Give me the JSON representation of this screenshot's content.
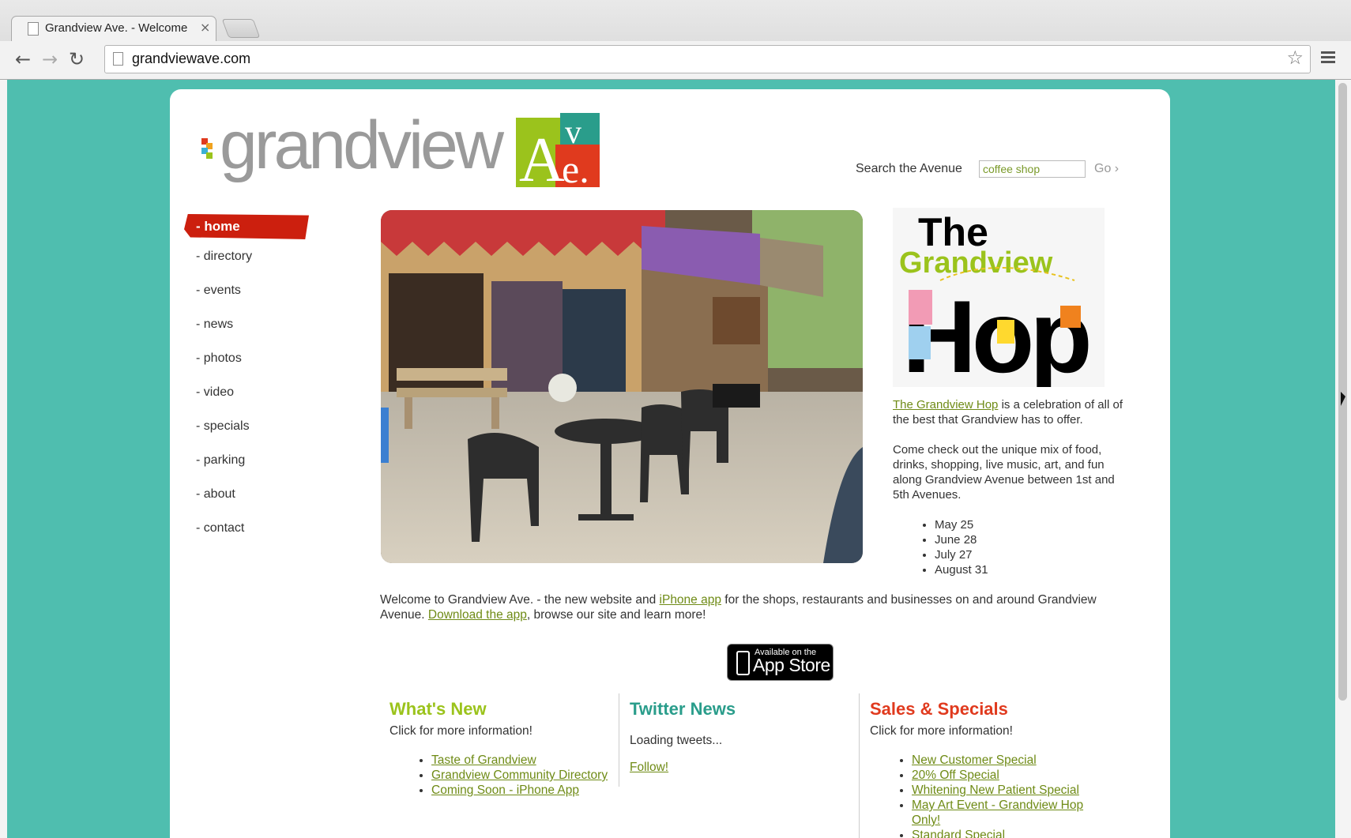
{
  "browser": {
    "tab_title": "Grandview Ave. - Welcome",
    "tab_close": "×",
    "url": "grandviewave.com",
    "back": "←",
    "forward": "→",
    "reload": "↻",
    "star": "☆"
  },
  "logo": {
    "wordmark": "grandview",
    "ave_letters": [
      "A",
      "v",
      "e."
    ]
  },
  "search": {
    "label": "Search the Avenue",
    "value": "coffee shop",
    "go": "Go ›"
  },
  "nav": {
    "items": [
      "- home",
      "- directory",
      "- events",
      "- news",
      "- photos",
      "- video",
      "- specials",
      "- parking",
      "- about",
      "- contact"
    ],
    "active_index": 0
  },
  "hop": {
    "poster_title_line1": "The",
    "poster_title_line2": "Grandview",
    "poster_title_line3": "Hop",
    "intro_link": "The Grandview Hop",
    "intro_rest": " is a celebration of all of the best that Grandview has to offer.",
    "body": "Come check out the unique mix of food, drinks, shopping, live music, art, and fun along Grandview Avenue between 1st and 5th Avenues.",
    "dates": [
      "May 25",
      "June 28",
      "July 27",
      "August 31"
    ]
  },
  "welcome": {
    "part1": "Welcome to Grandview Ave. - the new website and ",
    "link1": "iPhone app",
    "part2": " for the shops, restaurants and businesses on and around Grandview Avenue. ",
    "link2": "Download the app",
    "part3": ", browse our site and learn more!"
  },
  "appstore": {
    "small": "Available on the",
    "big": "App Store"
  },
  "whats_new": {
    "title": "What's New",
    "intro": "Click for more information!",
    "items": [
      "Taste of Grandview",
      "Grandview Community Directory",
      "Coming Soon - iPhone App"
    ],
    "color": "#9bc31c"
  },
  "twitter": {
    "title": "Twitter News",
    "loading": "Loading tweets...",
    "follow": "Follow!",
    "color": "#2a9d8b"
  },
  "sales": {
    "title": "Sales & Specials",
    "intro": "Click for more information!",
    "items": [
      "New Customer Special",
      "20% Off Special",
      "Whitening New Patient Special",
      "May Art Event - Grandview Hop Only!",
      "Standard Special"
    ],
    "color": "#e03a1e"
  },
  "colors": {
    "page_bg": "#4fbeaf",
    "nav_active": "#cc1f0e",
    "link": "#6f8b16"
  }
}
